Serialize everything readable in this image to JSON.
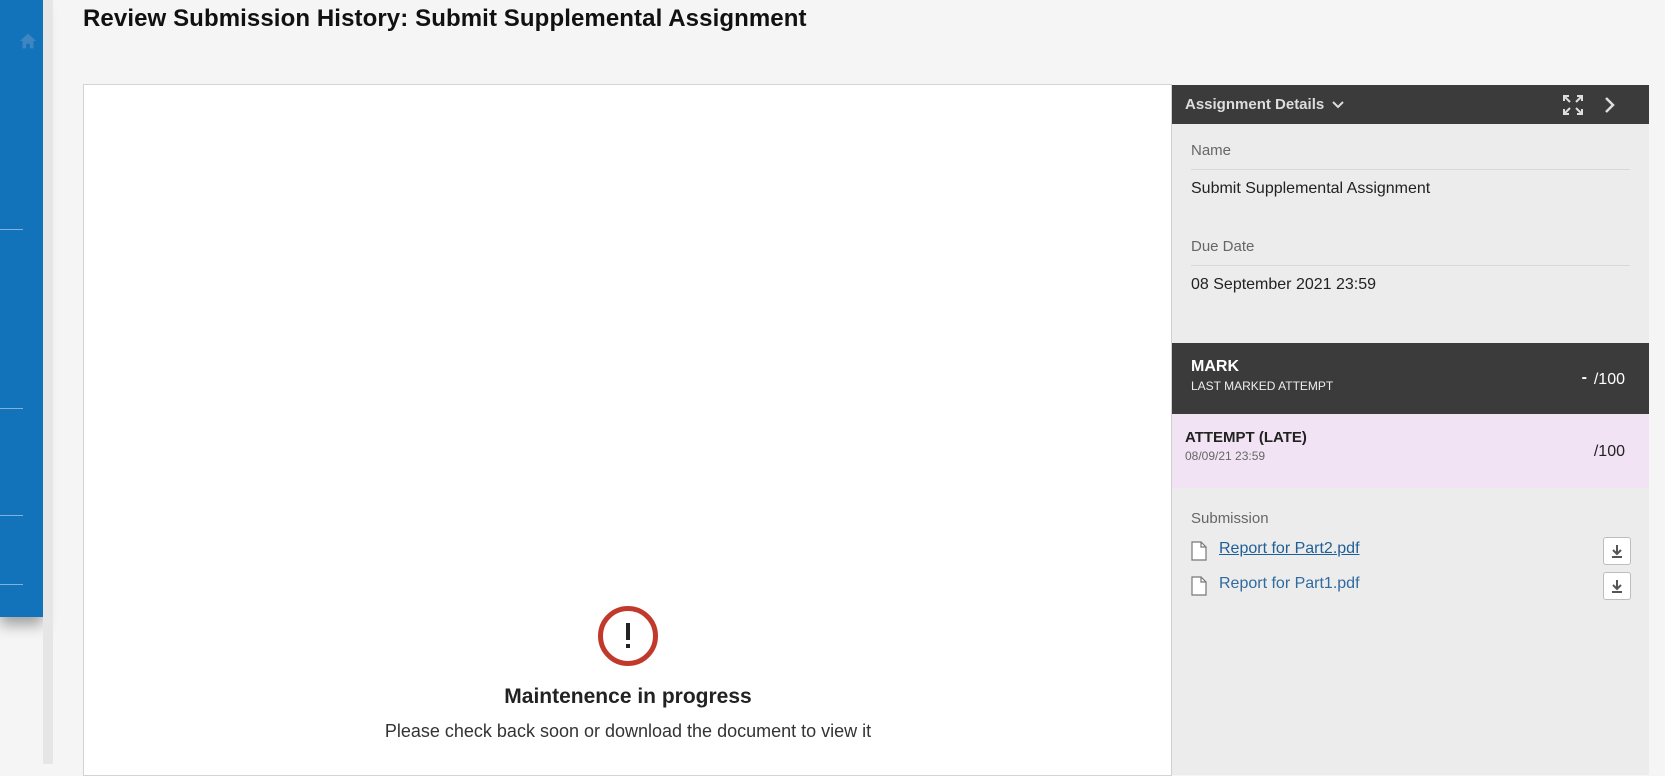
{
  "page": {
    "title": "Review Submission History: Submit Supplemental Assignment"
  },
  "nav": {
    "home_icon": "home-icon"
  },
  "viewer": {
    "maintenance_title": "Maintenence in progress",
    "maintenance_message": "Please check back soon or download the document to view it",
    "warning_icon": "exclamation-circle-icon"
  },
  "panel": {
    "header_title": "Assignment Details",
    "name_label": "Name",
    "name_value": "Submit Supplemental Assignment",
    "due_label": "Due Date",
    "due_value": "08 September 2021 23:59",
    "mark": {
      "title": "MARK",
      "subtitle": "LAST MARKED ATTEMPT",
      "score_placeholder": "-",
      "score_total": "/100"
    },
    "attempt": {
      "title": "ATTEMPT (LATE)",
      "date": "08/09/21 23:59",
      "score_total": "/100",
      "background": "#f1e3f4"
    },
    "submission_label": "Submission",
    "files": [
      {
        "name": "Report for Part2.pdf"
      },
      {
        "name": "Report for Part1.pdf"
      }
    ]
  },
  "colors": {
    "nav_blue": "#1273bb",
    "panel_dark": "#3b3b3b",
    "link": "#2f6aa0",
    "warning_red": "#c0392b"
  }
}
